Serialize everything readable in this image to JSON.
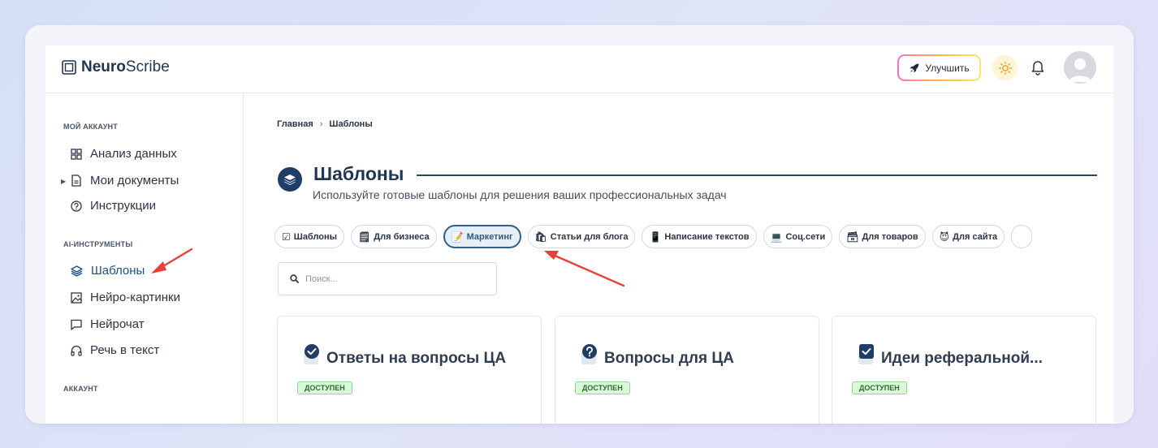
{
  "brand": {
    "bold": "Neuro",
    "regular": "Scribe"
  },
  "header": {
    "upgrade_label": "Улучшить"
  },
  "sidebar": {
    "section_account": "МОЙ АККАУНТ",
    "account_items": [
      {
        "label": "Анализ данных",
        "icon": "grid-icon"
      },
      {
        "label": "Мои документы",
        "icon": "document-icon"
      },
      {
        "label": "Инструкции",
        "icon": "help-icon"
      }
    ],
    "section_ai": "AI-ИНСТРУМЕНТЫ",
    "ai_items": [
      {
        "label": "Шаблоны",
        "icon": "layers-icon"
      },
      {
        "label": "Нейро-картинки",
        "icon": "image-icon"
      },
      {
        "label": "Нейрочат",
        "icon": "chat-icon"
      },
      {
        "label": "Речь в текст",
        "icon": "headphones-icon"
      }
    ],
    "section_bottom": "АККАУНТ"
  },
  "breadcrumb": {
    "home": "Главная",
    "separator": "›",
    "current": "Шаблоны"
  },
  "page": {
    "title": "Шаблоны",
    "subtitle": "Используйте готовые шаблоны для решения ваших профессиональных задач"
  },
  "categories": [
    {
      "label": "Шаблоны",
      "icon": "☑"
    },
    {
      "label": "Для бизнеса",
      "icon": "🗒"
    },
    {
      "label": "Маркетинг",
      "icon": "📝",
      "active": true
    },
    {
      "label": "Статьи для блога",
      "icon": "🛍"
    },
    {
      "label": "Написание текстов",
      "icon": "📱"
    },
    {
      "label": "Соц.сети",
      "icon": "💻"
    },
    {
      "label": "Для товаров",
      "icon": "🗃"
    },
    {
      "label": "Для сайта",
      "icon": "😈"
    }
  ],
  "search": {
    "placeholder": "Поиск..."
  },
  "cards": [
    {
      "title": "Ответы на вопросы ЦА",
      "badge": "ДОСТУПЕН"
    },
    {
      "title": "Вопросы для ЦА",
      "badge": "ДОСТУПЕН"
    },
    {
      "title": "Идеи реферальной...",
      "badge": "ДОСТУПЕН"
    }
  ],
  "colors": {
    "accent": "#1f3d66",
    "annotation_arrow": "#e8413c",
    "badge_bg": "#dcf7dc"
  }
}
